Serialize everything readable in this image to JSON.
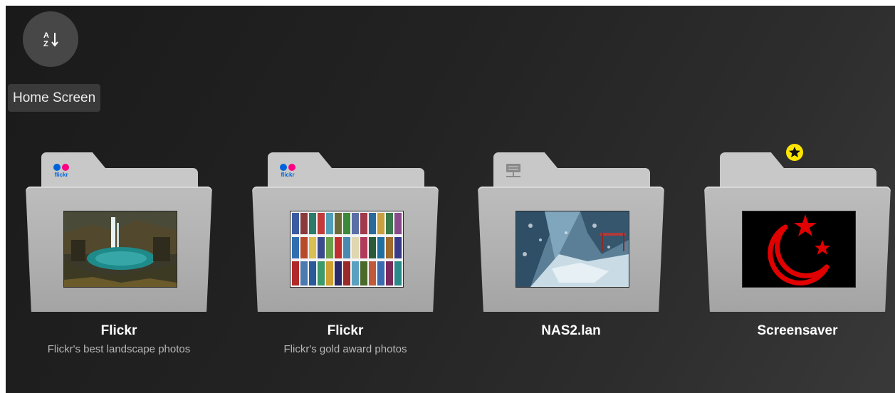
{
  "header": {
    "sort_button_icon": "sort-alpha-icon",
    "section_label": "Home Screen"
  },
  "folders": [
    {
      "title": "Flickr",
      "subtitle": "Flickr's best landscape photos",
      "badge": "flickr-logo-icon"
    },
    {
      "title": "Flickr",
      "subtitle": "Flickr's gold award photos",
      "badge": "flickr-logo-icon"
    },
    {
      "title": "NAS2.lan",
      "subtitle": "",
      "badge": "network-server-icon"
    },
    {
      "title": "Screensaver",
      "subtitle": "",
      "badge": "favorite-star-icon"
    }
  ],
  "badges": {
    "flickr_word": "flickr"
  },
  "colors": {
    "background": "#1e1e1e",
    "folder": "#b3b3b3",
    "flickr_blue": "#0063dc",
    "flickr_pink": "#ff0084",
    "favorite_star": "#ffe600",
    "screensaver_red": "#e00000"
  }
}
